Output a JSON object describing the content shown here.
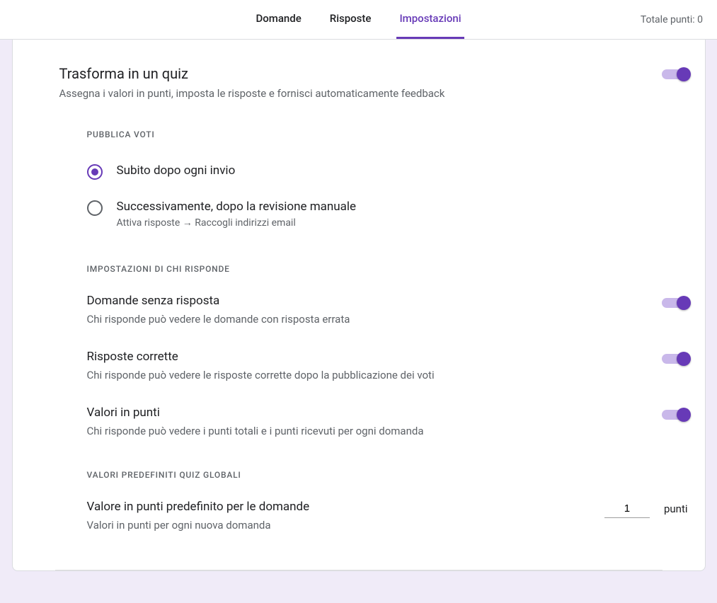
{
  "tabs": {
    "questions": "Domande",
    "responses": "Risposte",
    "settings": "Impostazioni"
  },
  "total_points_label": "Totale punti: 0",
  "quiz_toggle": {
    "title": "Trasforma in un quiz",
    "sub": "Assegna i valori in punti, imposta le risposte e fornisci automaticamente feedback"
  },
  "release_grades": {
    "heading": "PUBBLICA VOTI",
    "option1": "Subito dopo ogni invio",
    "option2": "Successivamente, dopo la revisione manuale",
    "option2_sub": "Attiva risposte → Raccogli indirizzi email"
  },
  "respondent_heading": "IMPOSTAZIONI DI CHI RISPONDE",
  "missed": {
    "title": "Domande senza risposta",
    "sub": "Chi risponde può vedere le domande con risposta errata"
  },
  "correct": {
    "title": "Risposte corrette",
    "sub": "Chi risponde può vedere le risposte corrette dopo la pubblicazione dei voti"
  },
  "points": {
    "title": "Valori in punti",
    "sub": "Chi risponde può vedere i punti totali e i punti ricevuti per ogni domanda"
  },
  "defaults_heading": "VALORI PREDEFINITI QUIZ GLOBALI",
  "default_points": {
    "title": "Valore in punti predefinito per le domande",
    "sub": "Valori in punti per ogni nuova domanda",
    "value": "1",
    "unit": "punti"
  }
}
